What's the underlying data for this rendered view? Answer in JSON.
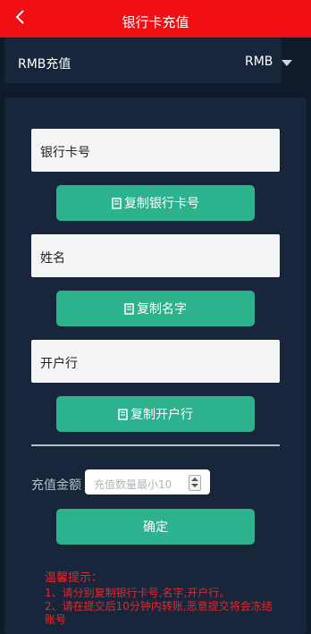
{
  "header": {
    "title": "银行卡充值",
    "back_icon": "chevron-left-icon"
  },
  "currency": {
    "label": "RMB充值",
    "value": "RMB",
    "caret_icon": "caret-down-icon"
  },
  "fields": {
    "bank_card": {
      "label": "银行卡号",
      "copy_label": "复制银行卡号"
    },
    "name": {
      "label": "姓名",
      "copy_label": "复制名字"
    },
    "bank": {
      "label": "开户行",
      "copy_label": "复制开户行"
    }
  },
  "amount": {
    "label": "充值金额：",
    "placeholder": "充值数量最小10"
  },
  "confirm_label": "确定",
  "tips": {
    "title": "温馨提示：",
    "lines": [
      "1、请分别复制银行卡号,名字,开户行。",
      "2、请在提交后10分钟内转账,恶意提交将会冻结账号"
    ]
  },
  "colors": {
    "header_bg": "#f20f14",
    "accent": "#2db28e",
    "panel_bg": "#17263a",
    "page_bg": "#0f1a2b",
    "tip_text": "#e6262b"
  }
}
